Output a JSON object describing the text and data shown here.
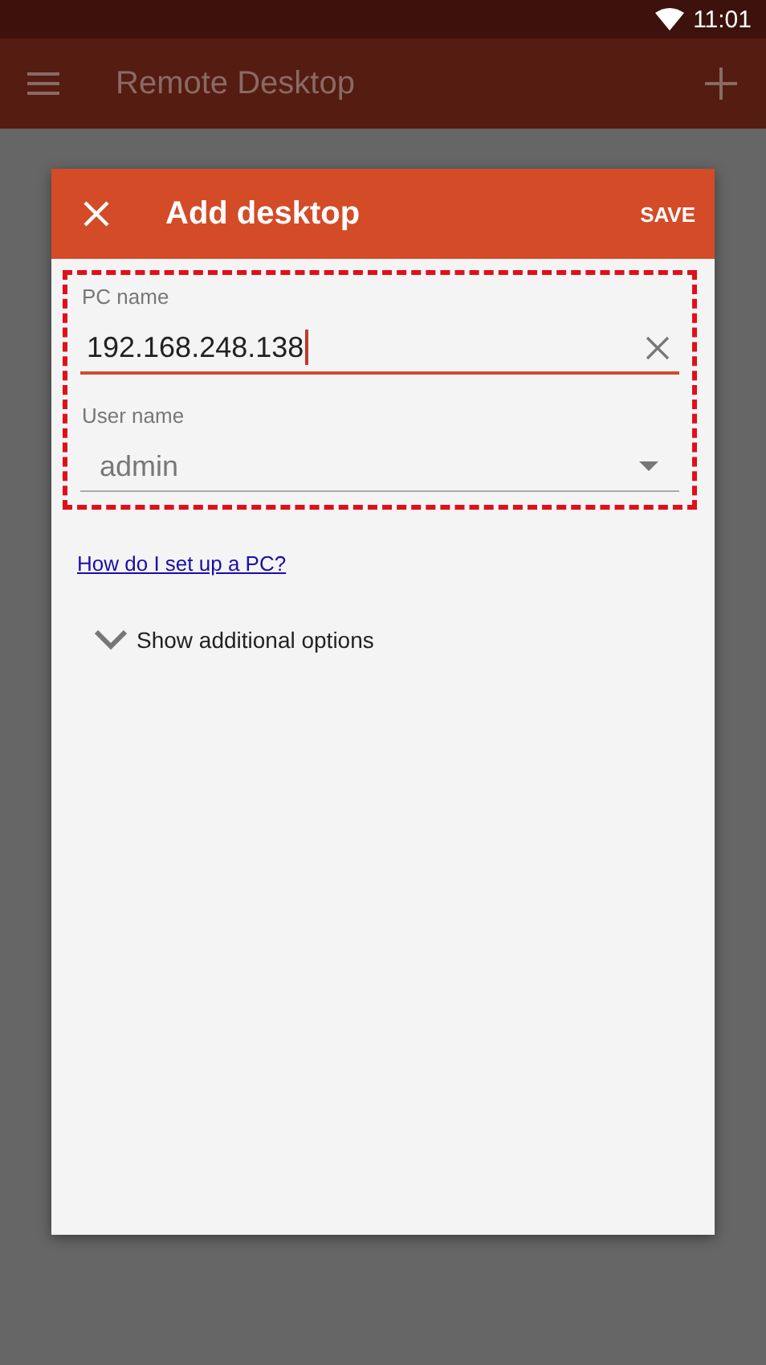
{
  "status_bar": {
    "time": "11:01"
  },
  "app_bar": {
    "title": "Remote Desktop"
  },
  "dialog": {
    "title": "Add desktop",
    "action": "SAVE",
    "fields": [
      {
        "kind": "text",
        "label": "PC name",
        "value": "192.168.248.138",
        "focused": true
      },
      {
        "kind": "dropdown",
        "label": "User name",
        "value": "admin",
        "focused": false
      }
    ],
    "highlighted": true,
    "link": "How do I set up a PC?",
    "expander": {
      "label": "Show additional options",
      "expanded": false
    }
  }
}
